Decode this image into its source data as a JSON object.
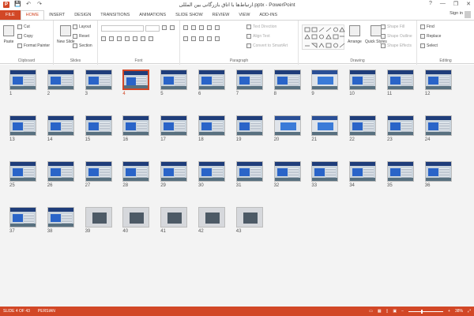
{
  "window": {
    "title": "ارتباط‌ها با اتاق بازرگانی بین المللی.pptx - PowerPoint",
    "controls": [
      "?",
      "—",
      "❐",
      "✕"
    ]
  },
  "qat": {
    "app_icon": "P",
    "save": "💾",
    "undo": "↶",
    "redo": "↷"
  },
  "tabs": [
    "FILE",
    "HOME",
    "INSERT",
    "DESIGN",
    "TRANSITIONS",
    "ANIMATIONS",
    "SLIDE SHOW",
    "REVIEW",
    "VIEW",
    "ADD-INS"
  ],
  "active_tab": "HOME",
  "account": {
    "signin": "Sign in"
  },
  "ribbon": {
    "clipboard": {
      "label": "Clipboard",
      "paste": "Paste",
      "cut": "Cut",
      "copy": "Copy",
      "format_painter": "Format Painter"
    },
    "slides": {
      "label": "Slides",
      "new_slide": "New Slide",
      "layout": "Layout",
      "reset": "Reset",
      "section": "Section"
    },
    "font": {
      "label": "Font"
    },
    "paragraph": {
      "label": "Paragraph",
      "text_direction": "Text Direction",
      "align_text": "Align Text",
      "smartart": "Convert to SmartArt"
    },
    "drawing": {
      "label": "Drawing",
      "arrange": "Arrange",
      "quick_styles": "Quick Styles",
      "shape_fill": "Shape Fill",
      "shape_outline": "Shape Outline",
      "shape_effects": "Shape Effects"
    },
    "editing": {
      "label": "Editing",
      "find": "Find",
      "replace": "Replace",
      "select": "Select"
    }
  },
  "slides": [
    "1",
    "2",
    "3",
    "4",
    "5",
    "6",
    "7",
    "8",
    "9",
    "10",
    "11",
    "12",
    "13",
    "14",
    "15",
    "16",
    "17",
    "18",
    "19",
    "20",
    "21",
    "22",
    "23",
    "24",
    "25",
    "26",
    "27",
    "28",
    "29",
    "30",
    "31",
    "32",
    "33",
    "34",
    "35",
    "36",
    "37",
    "38",
    "39",
    "40",
    "41",
    "42",
    "43"
  ],
  "selected_slide": "4",
  "status": {
    "slide_info": "SLIDE 4 OF 43",
    "language": "PERSIAN",
    "zoom": "38%"
  }
}
